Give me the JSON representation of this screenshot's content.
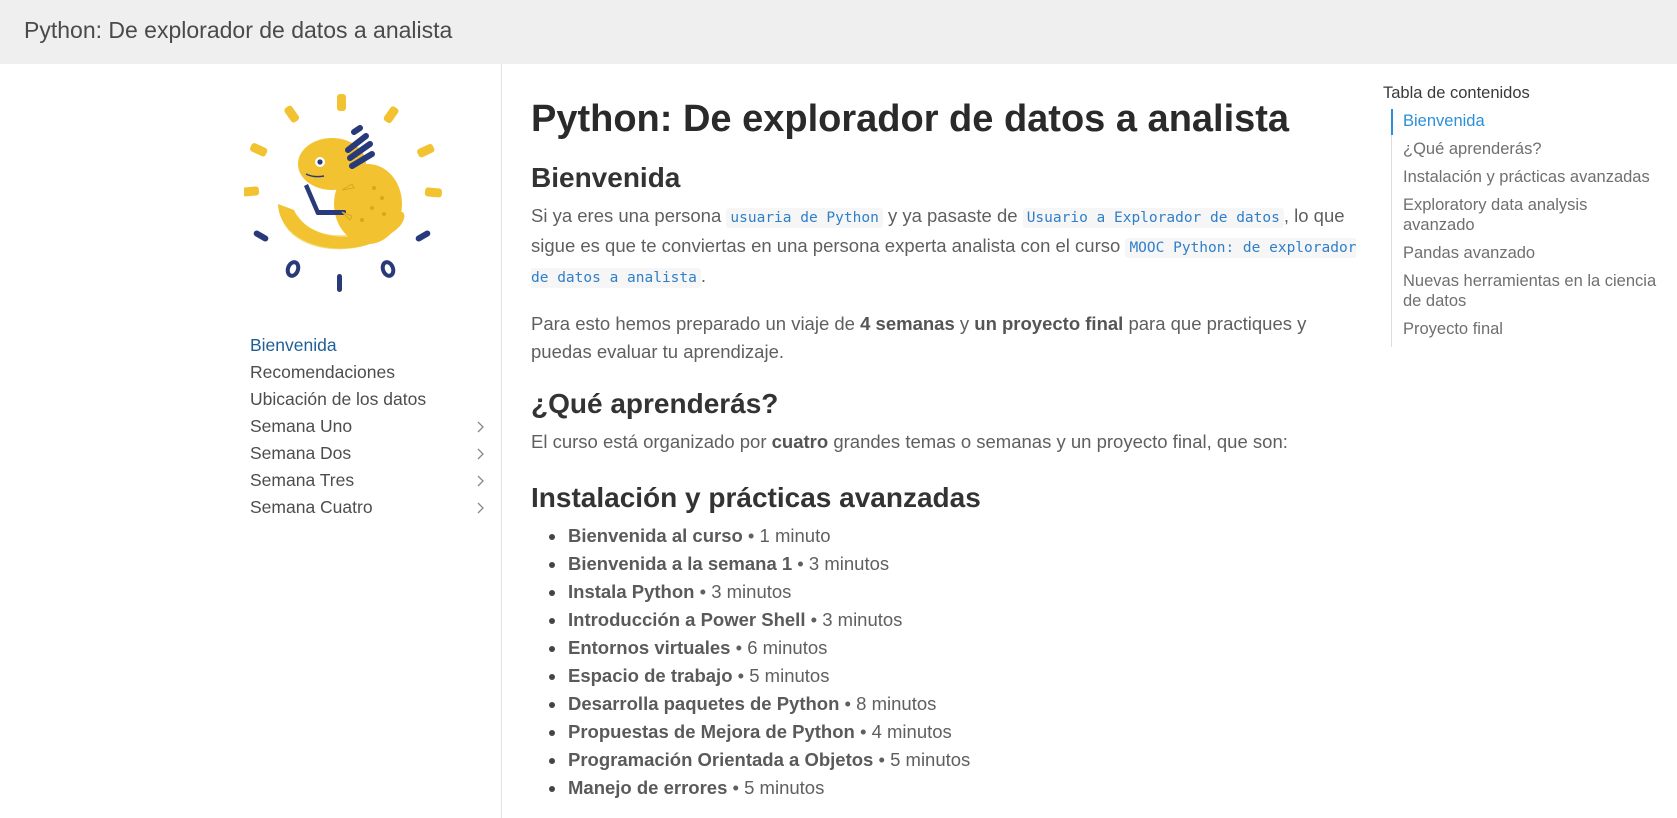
{
  "header": {
    "title": "Python: De explorador de datos a analista"
  },
  "sidebar": {
    "logo_icon": "axolotl-logo",
    "items": [
      {
        "label": "Bienvenida",
        "active": true,
        "expandable": false
      },
      {
        "label": "Recomendaciones",
        "active": false,
        "expandable": false
      },
      {
        "label": "Ubicación de los datos",
        "active": false,
        "expandable": false
      },
      {
        "label": "Semana Uno",
        "active": false,
        "expandable": true
      },
      {
        "label": "Semana Dos",
        "active": false,
        "expandable": true
      },
      {
        "label": "Semana Tres",
        "active": false,
        "expandable": true
      },
      {
        "label": "Semana Cuatro",
        "active": false,
        "expandable": true
      }
    ]
  },
  "main": {
    "title": "Python: De explorador de datos a analista",
    "welcome": {
      "heading": "Bienvenida",
      "p1": {
        "t1": "Si ya eres una persona ",
        "code1": "usuaria de Python",
        "t2": " y ya pasaste de ",
        "code2": "Usuario a Explorador de datos",
        "t3": ", lo que sigue es que te conviertas en una persona experta analista con el curso ",
        "code3": "MOOC Python: de explorador de datos a analista",
        "t4": "."
      },
      "p2": {
        "t1": "Para esto hemos preparado un viaje de ",
        "b1": "4 semanas",
        "t2": " y ",
        "b2": "un proyecto final",
        "t3": " para que practiques y puedas evaluar tu aprendizaje."
      }
    },
    "learn": {
      "heading": "¿Qué aprenderás?",
      "t1": "El curso está organizado por ",
      "b1": "cuatro",
      "t2": " grandes temas o semanas y un proyecto final, que son:"
    },
    "install": {
      "heading": "Instalación y prácticas avanzadas",
      "lessons": [
        {
          "title": "Bienvenida al curso",
          "duration": " • 1 minuto"
        },
        {
          "title": "Bienvenida a la semana 1",
          "duration": " • 3 minutos"
        },
        {
          "title": "Instala Python",
          "duration": " • 3 minutos"
        },
        {
          "title": "Introducción a Power Shell",
          "duration": " • 3 minutos"
        },
        {
          "title": "Entornos virtuales",
          "duration": " • 6 minutos"
        },
        {
          "title": "Espacio de trabajo",
          "duration": " • 5 minutos"
        },
        {
          "title": "Desarrolla paquetes de Python",
          "duration": " • 8 minutos"
        },
        {
          "title": "Propuestas de Mejora de Python",
          "duration": " • 4 minutos"
        },
        {
          "title": "Programación Orientada a Objetos",
          "duration": " • 5 minutos"
        },
        {
          "title": "Manejo de errores",
          "duration": " • 5 minutos"
        }
      ]
    }
  },
  "toc": {
    "title": "Tabla de contenidos",
    "items": [
      {
        "label": "Bienvenida",
        "active": true
      },
      {
        "label": "¿Qué aprenderás?",
        "active": false
      },
      {
        "label": "Instalación y prácticas avanzadas",
        "active": false
      },
      {
        "label": "Exploratory data analysis avanzado",
        "active": false
      },
      {
        "label": "Pandas avanzado",
        "active": false
      },
      {
        "label": "Nuevas herramientas en la ciencia de datos",
        "active": false
      },
      {
        "label": "Proyecto final",
        "active": false
      }
    ]
  },
  "colors": {
    "accent": "#2d8fd8",
    "nav_active": "#1f5f96",
    "logo_yellow": "#f2c230",
    "logo_navy": "#283a7a",
    "topbar": "#efefef"
  }
}
